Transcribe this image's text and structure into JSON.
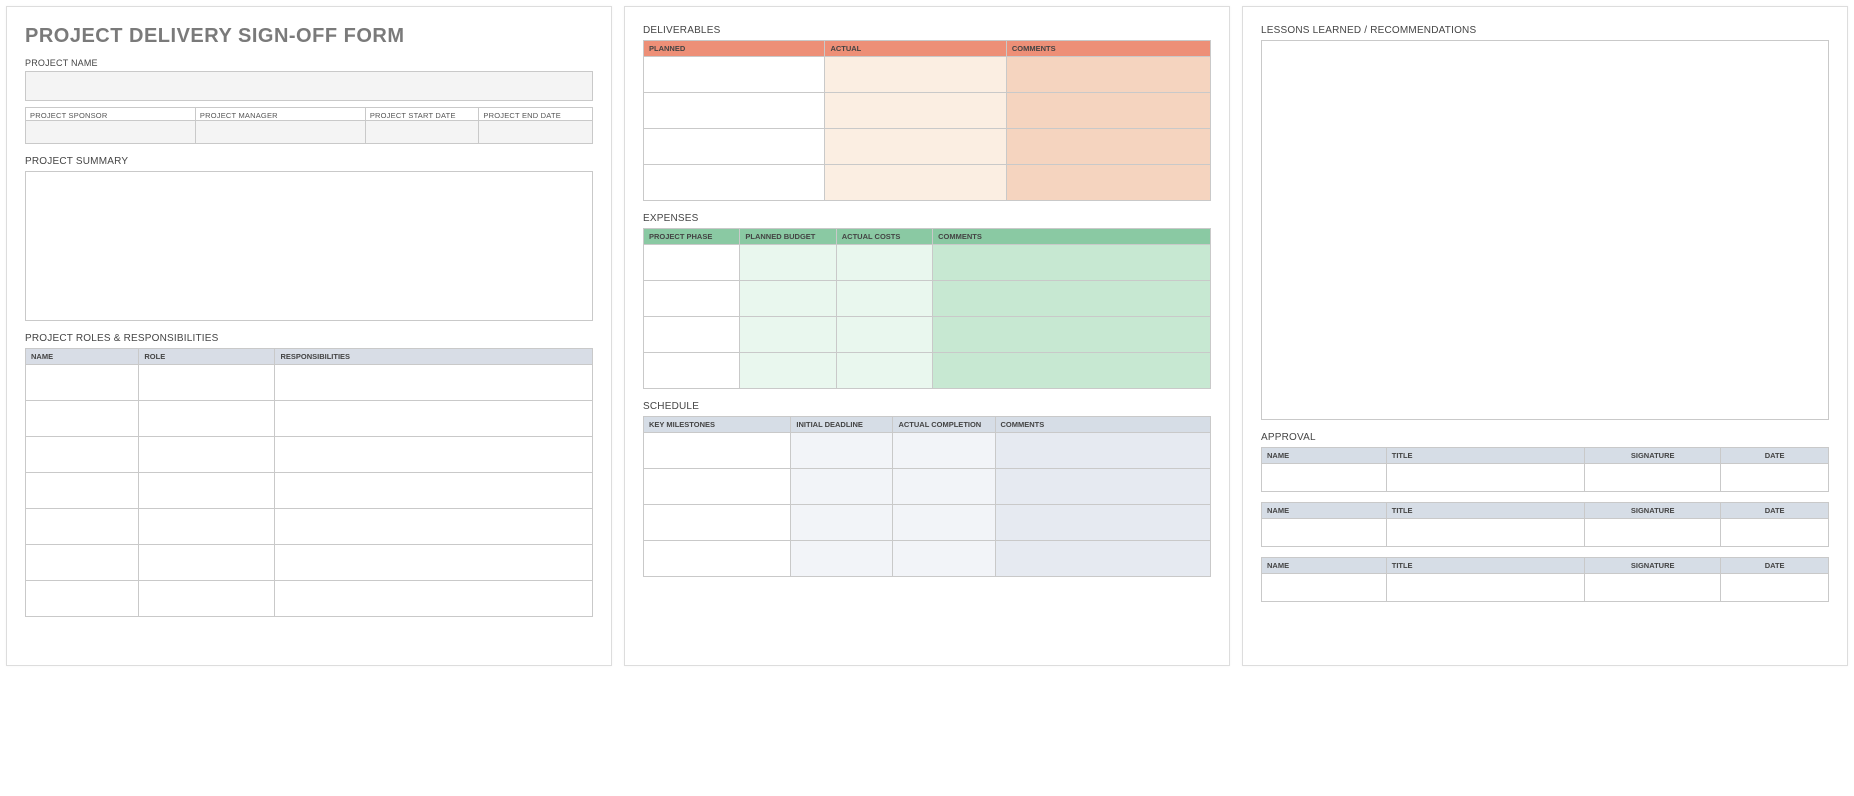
{
  "page1": {
    "title": "PROJECT DELIVERY SIGN-OFF FORM",
    "project_name_label": "PROJECT NAME",
    "meta": {
      "sponsor": "PROJECT SPONSOR",
      "manager": "PROJECT MANAGER",
      "start": "PROJECT START DATE",
      "end": "PROJECT END DATE"
    },
    "summary_label": "PROJECT SUMMARY",
    "roles_label": "PROJECT ROLES & RESPONSIBILITIES",
    "roles_headers": {
      "name": "NAME",
      "role": "ROLE",
      "resp": "RESPONSIBILITIES"
    }
  },
  "page2": {
    "deliverables_label": "DELIVERABLES",
    "deliv_headers": {
      "planned": "PLANNED",
      "actual": "ACTUAL",
      "comments": "COMMENTS"
    },
    "expenses_label": "EXPENSES",
    "exp_headers": {
      "phase": "PROJECT PHASE",
      "budget": "PLANNED BUDGET",
      "actual": "ACTUAL COSTS",
      "comments": "COMMENTS"
    },
    "schedule_label": "SCHEDULE",
    "sched_headers": {
      "milestones": "KEY MILESTONES",
      "initial": "INITIAL DEADLINE",
      "actual": "ACTUAL COMPLETION",
      "comments": "COMMENTS"
    }
  },
  "page3": {
    "lessons_label": "LESSONS LEARNED / RECOMMENDATIONS",
    "approval_label": "APPROVAL",
    "approval_headers": {
      "name": "NAME",
      "title": "TITLE",
      "sig": "SIGNATURE",
      "date": "DATE"
    }
  }
}
